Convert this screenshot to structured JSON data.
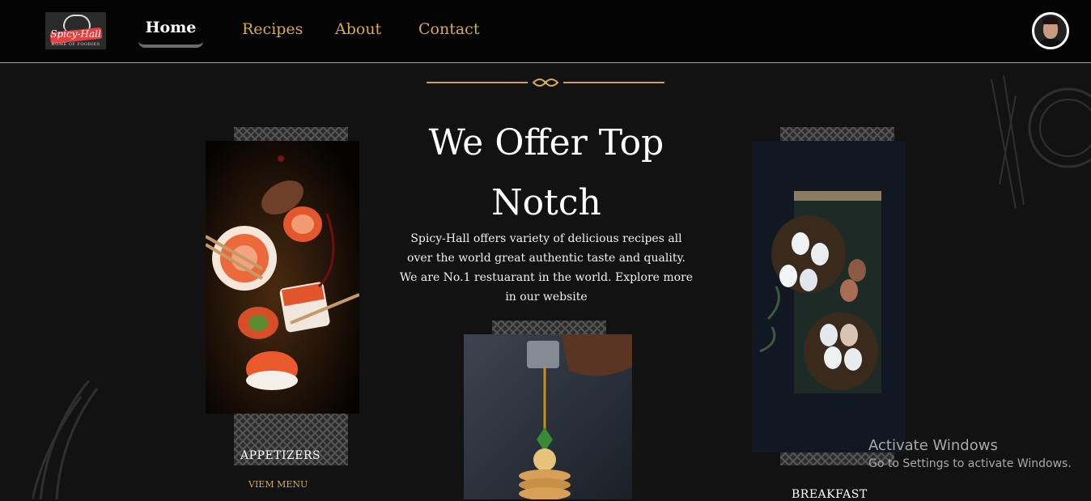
{
  "brand": {
    "name": "Spicy-Hall",
    "tagline": "HOME OF FOODIES"
  },
  "nav": {
    "home": "Home",
    "recipes": "Recipes",
    "about": "About",
    "contact": "Contact"
  },
  "hero": {
    "heading_line1": "We Offer Top",
    "heading_line2": "Notch",
    "description": "Spicy-Hall offers variety of delicious recipes all over the world great authentic taste and quality. We are No.1 restuarant in the world. Explore more in our website"
  },
  "categories": [
    {
      "label": "APPETIZERS",
      "link": "VIEM MENU"
    },
    {
      "label": "BREAKFAST"
    }
  ],
  "watermark": {
    "line1": "Activate Windows",
    "line2": "Go to Settings to activate Windows."
  },
  "colors": {
    "accent": "#d9a954",
    "background": "#121212",
    "nav_background": "#040404"
  }
}
